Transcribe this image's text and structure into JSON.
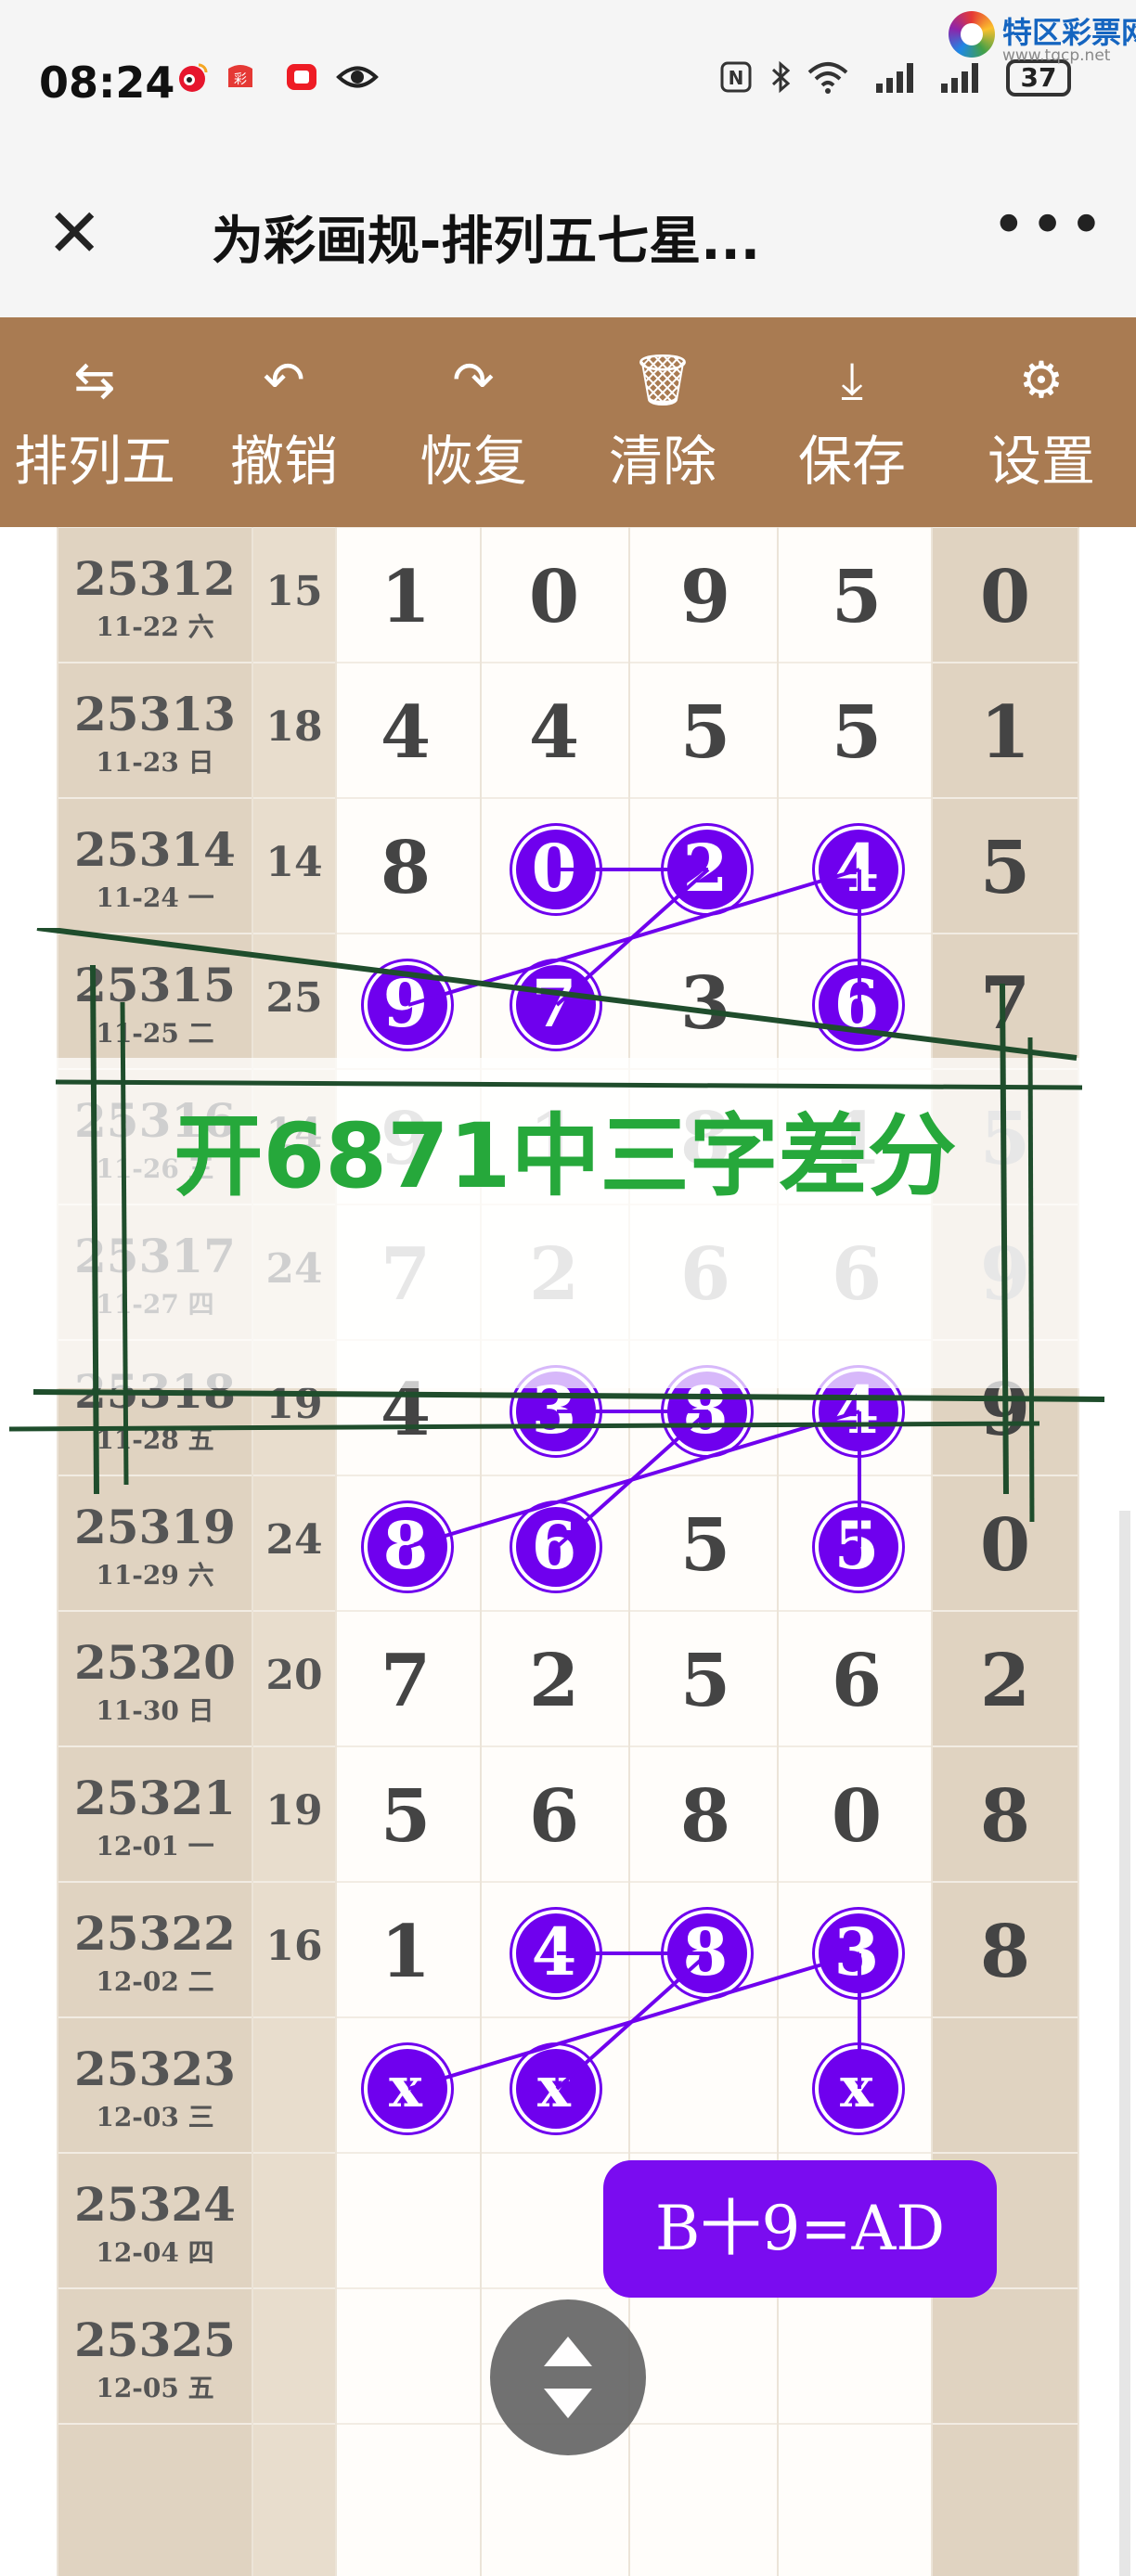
{
  "status": {
    "time": "08:24",
    "battery": "37",
    "icons": [
      "weibo-icon",
      "lottery-app-icon",
      "red-app-icon",
      "eye-icon",
      "nfc-icon",
      "bluetooth-icon",
      "wifi-icon",
      "signal-icon",
      "signal-icon-2",
      "battery-icon"
    ]
  },
  "watermark": {
    "name": "特区彩票网",
    "url": "www.tqcp.net"
  },
  "nav": {
    "close": "✕",
    "title": "为彩画规-排列五七星...",
    "more": "•••"
  },
  "toolbar": {
    "buttons": [
      {
        "icon": "swap-icon",
        "glyph": "⇆",
        "label": "排列五"
      },
      {
        "icon": "undo-icon",
        "glyph": "↶",
        "label": "撤销"
      },
      {
        "icon": "redo-icon",
        "glyph": "↷",
        "label": "恢复"
      },
      {
        "icon": "trash-icon",
        "glyph": "🗑",
        "label": "清除"
      },
      {
        "icon": "download-icon",
        "glyph": "⤓",
        "label": "保存"
      },
      {
        "icon": "gear-icon",
        "glyph": "⚙",
        "label": "设置"
      }
    ]
  },
  "rows": [
    {
      "issue": "25312",
      "date": "11-22 六",
      "sum": "15",
      "digits": [
        "1",
        "0",
        "9",
        "5",
        "0"
      ]
    },
    {
      "issue": "25313",
      "date": "11-23 日",
      "sum": "18",
      "digits": [
        "4",
        "4",
        "5",
        "5",
        "1"
      ]
    },
    {
      "issue": "25314",
      "date": "11-24 一",
      "sum": "14",
      "digits": [
        "8",
        "0",
        "2",
        "4",
        "5"
      ]
    },
    {
      "issue": "25315",
      "date": "11-25 二",
      "sum": "25",
      "digits": [
        "9",
        "7",
        "3",
        "6",
        "7"
      ]
    },
    {
      "issue": "25316",
      "date": "11-26 三",
      "sum": "14",
      "digits": [
        "9",
        "1",
        "8",
        "1",
        "5"
      ]
    },
    {
      "issue": "25317",
      "date": "11-27 四",
      "sum": "24",
      "digits": [
        "7",
        "2",
        "6",
        "6",
        "9"
      ]
    },
    {
      "issue": "25318",
      "date": "11-28 五",
      "sum": "19",
      "digits": [
        "4",
        "3",
        "8",
        "4",
        "9"
      ]
    },
    {
      "issue": "25319",
      "date": "11-29 六",
      "sum": "24",
      "digits": [
        "8",
        "6",
        "5",
        "5",
        "0"
      ]
    },
    {
      "issue": "25320",
      "date": "11-30 日",
      "sum": "20",
      "digits": [
        "7",
        "2",
        "5",
        "6",
        "2"
      ]
    },
    {
      "issue": "25321",
      "date": "12-01 一",
      "sum": "19",
      "digits": [
        "5",
        "6",
        "8",
        "0",
        "8"
      ]
    },
    {
      "issue": "25322",
      "date": "12-02 二",
      "sum": "16",
      "digits": [
        "1",
        "4",
        "8",
        "3",
        "8"
      ]
    },
    {
      "issue": "25323",
      "date": "12-03 三",
      "sum": "",
      "digits": [
        "x",
        "x",
        "",
        "x",
        ""
      ]
    },
    {
      "issue": "25324",
      "date": "12-04 四",
      "sum": "",
      "digits": [
        "",
        "",
        "",
        "",
        ""
      ]
    },
    {
      "issue": "25325",
      "date": "12-05 五",
      "sum": "",
      "digits": [
        "",
        "",
        "",
        "",
        ""
      ]
    }
  ],
  "overlay": {
    "text": "开6871中三字差分"
  },
  "formula": {
    "text": "B十9=AD"
  },
  "colors": {
    "toolbar": "#a97b52",
    "bubble": "#6f00ee",
    "overlay_text": "#26a83b",
    "side_column": "#e0d3c1",
    "formula": "#7a0cf0"
  }
}
